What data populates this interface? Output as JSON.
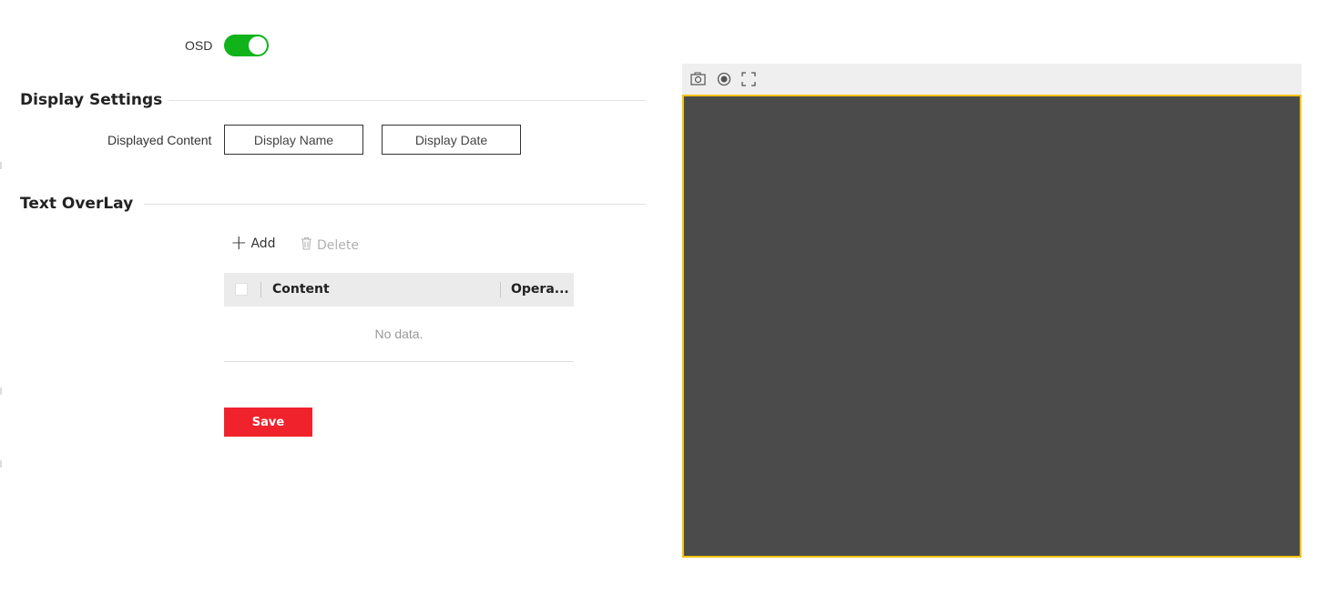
{
  "osd": {
    "label": "OSD",
    "enabled": true,
    "toggle_color": "#10b31a"
  },
  "display_settings": {
    "title": "Display Settings",
    "content_label": "Displayed Content",
    "options": [
      "Display Name",
      "Display Date"
    ]
  },
  "text_overlay": {
    "title": "Text OverLay",
    "add_label": "Add",
    "delete_label": "Delete",
    "table": {
      "columns": [
        "Content",
        "Opera..."
      ],
      "rows": [],
      "empty_text": "No data."
    }
  },
  "save_label": "Save",
  "preview": {
    "toolbar_icons": [
      "camera-icon",
      "record-icon",
      "fullscreen-icon"
    ],
    "frame_color": "#f3c20e",
    "background_color": "#4b4b4b"
  }
}
